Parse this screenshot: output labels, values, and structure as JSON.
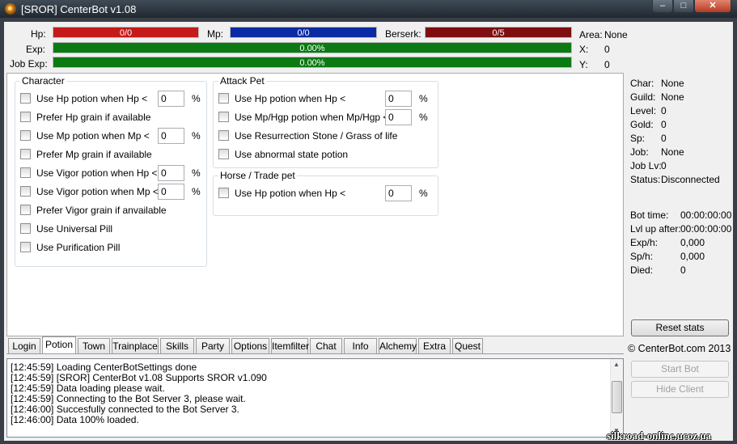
{
  "window": {
    "title": "[SROR] CenterBot v1.08",
    "min_symbol": "–",
    "max_symbol": "□",
    "close_symbol": "✕"
  },
  "stats_bar": {
    "hp_label": "Hp:",
    "hp_value": "0/0",
    "mp_label": "Mp:",
    "mp_value": "0/0",
    "berserk_label": "Berserk:",
    "berserk_value": "0/5",
    "exp_label": "Exp:",
    "exp_value": "0.00%",
    "jobexp_label": "Job Exp:",
    "jobexp_value": "0.00%",
    "area_label": "Area:",
    "area_value": "None",
    "x_label": "X:",
    "x_value": "0",
    "y_label": "Y:",
    "y_value": "0",
    "colors": {
      "hp": "#c41a1a",
      "mp": "#0b2aa3",
      "berserk": "#7e0e10",
      "exp": "#0b7a12"
    }
  },
  "character_group": {
    "title": "Character",
    "rows": [
      {
        "label": "Use Hp potion when Hp <",
        "value": "0",
        "unit": "%"
      },
      {
        "label": "Prefer Hp grain if available"
      },
      {
        "label": "Use Mp potion when Mp <",
        "value": "0",
        "unit": "%"
      },
      {
        "label": "Prefer Mp grain if available"
      },
      {
        "label": "Use Vigor potion when Hp <",
        "value": "0",
        "unit": "%"
      },
      {
        "label": "Use Vigor potion when Mp <",
        "value": "0",
        "unit": "%"
      },
      {
        "label": "Prefer Vigor grain if anvailable"
      },
      {
        "label": "Use Universal Pill"
      },
      {
        "label": "Use Purification Pill"
      }
    ]
  },
  "attack_pet_group": {
    "title": "Attack Pet",
    "rows": [
      {
        "label": "Use Hp potion when Hp <",
        "value": "0",
        "unit": "%"
      },
      {
        "label": "Use Mp/Hgp potion when Mp/Hgp <",
        "value": "0",
        "unit": "%"
      },
      {
        "label": "Use Resurrection Stone / Grass of life"
      },
      {
        "label": "Use abnormal state potion"
      }
    ]
  },
  "horse_group": {
    "title": "Horse / Trade pet",
    "rows": [
      {
        "label": "Use Hp potion when Hp <",
        "value": "0",
        "unit": "%"
      }
    ]
  },
  "tabs": [
    "Login",
    "Potion",
    "Town",
    "Trainplace",
    "Skills",
    "Party",
    "Options",
    "Itemfilter",
    "Chat",
    "Info",
    "Alchemy",
    "Extra",
    "Quest"
  ],
  "active_tab": "Potion",
  "log": [
    "[12:45:59] Loading CenterBotSettings done",
    "[12:45:59] [SROR] CenterBot v1.08 Supports SROR v1.090",
    "[12:45:59] Data loading please wait.",
    "[12:45:59] Connecting to the Bot Server 3, please wait.",
    "[12:46:00] Succesfully connected to the Bot Server 3.",
    "[12:46:00] Data 100% loaded."
  ],
  "info": {
    "char_label": "Char:",
    "char_value": "None",
    "guild_label": "Guild:",
    "guild_value": "None",
    "level_label": "Level:",
    "level_value": "0",
    "gold_label": "Gold:",
    "gold_value": "0",
    "sp_label": "Sp:",
    "sp_value": "0",
    "job_label": "Job:",
    "job_value": "None",
    "joblv_label": "Job Lv:",
    "joblv_value": "0",
    "status_label": "Status:",
    "status_value": "Disconnected"
  },
  "session": {
    "bottime_label": "Bot time:",
    "bottime_value": "00:00:00:00",
    "lvlup_label": "Lvl up after:",
    "lvlup_value": "00:00:00:00",
    "exph_label": "Exp/h:",
    "exph_value": "0,000",
    "sph_label": "Sp/h:",
    "sph_value": "0,000",
    "died_label": "Died:",
    "died_value": "0"
  },
  "buttons": {
    "reset_stats": "Reset stats",
    "copyright": "© CenterBot.com 2013",
    "start_bot": "Start Bot",
    "hide_client": "Hide Client"
  },
  "watermark": "silkroad-online.ucoz.ua"
}
